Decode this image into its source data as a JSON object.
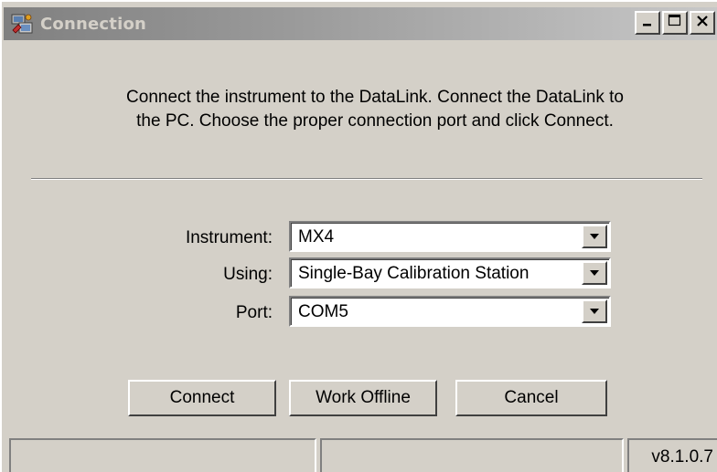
{
  "window": {
    "title": "Connection",
    "app_icon": "connection-app-icon",
    "controls": {
      "minimize_icon": "minimize-icon",
      "maximize_icon": "maximize-icon",
      "close_icon": "close-icon"
    }
  },
  "instructions": {
    "line1": "Connect the instrument to the DataLink.  Connect the DataLink to",
    "line2": "the PC.  Choose the proper connection port and click Connect."
  },
  "form": {
    "instrument": {
      "label": "Instrument:",
      "value": "MX4"
    },
    "using": {
      "label": "Using:",
      "value": "Single-Bay Calibration Station"
    },
    "port": {
      "label": "Port:",
      "value": "COM5"
    }
  },
  "buttons": {
    "connect": "Connect",
    "work_offline": "Work Offline",
    "cancel": "Cancel"
  },
  "statusbar": {
    "panel1": "",
    "panel2": "",
    "version": "v8.1.0.7"
  },
  "colors": {
    "face": "#d4d0c8",
    "title_gradient_start": "#808080",
    "title_gradient_end": "#c8c8c8",
    "title_text": "#d4d0c8"
  }
}
